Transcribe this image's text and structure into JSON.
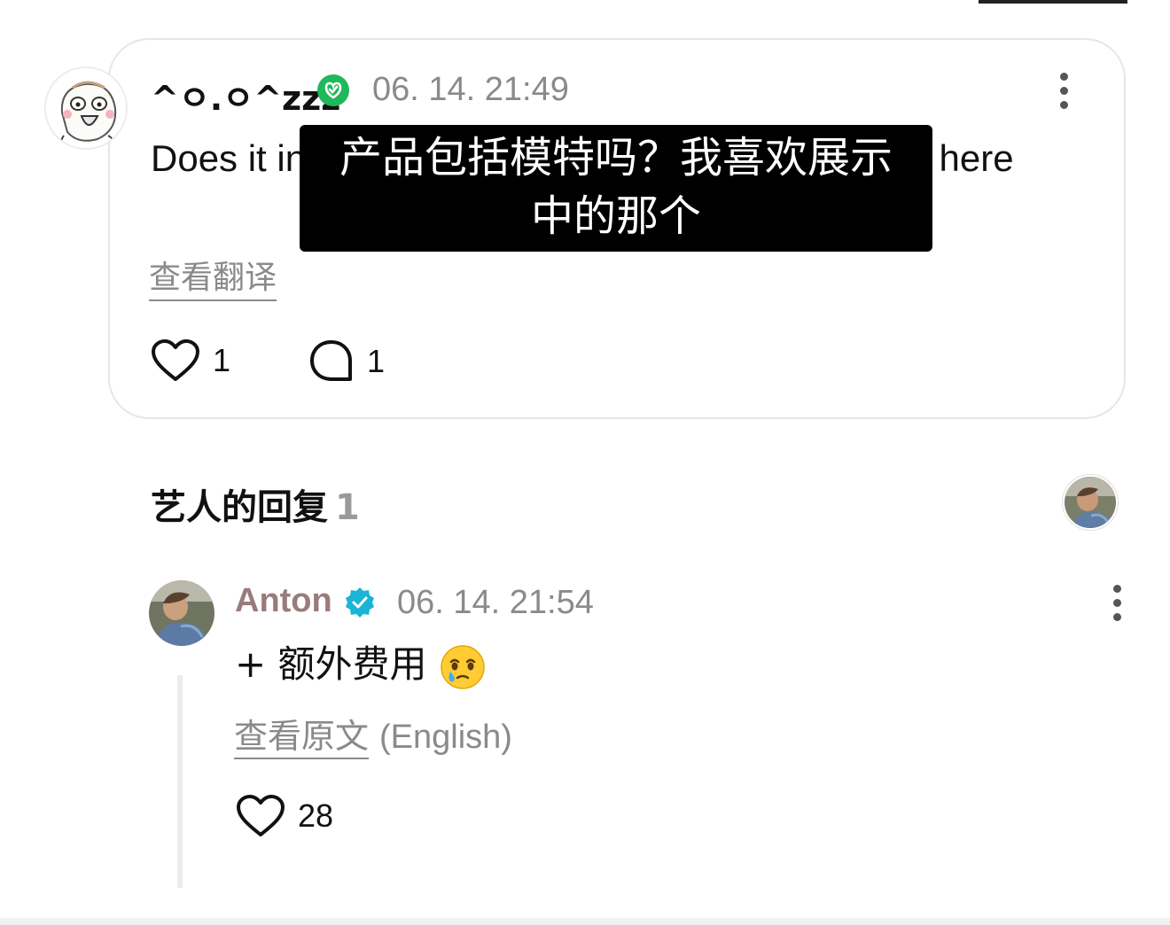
{
  "comment": {
    "username": "^ㅇ.ㅇ^zzz",
    "timestamp": "06. 14. 21:49",
    "text": "Does it include the model? I like the one shown here",
    "translate_label": "查看翻译",
    "likes": "1",
    "replies": "1",
    "verified_color": "#1fb85a",
    "icons": [
      "avatar-icon",
      "verified-badge-icon",
      "more-vertical-icon",
      "heart-icon",
      "comment-bubble-icon"
    ]
  },
  "overlay": {
    "line1": "产品包括模特吗？我喜欢展示",
    "line2": "中的那个"
  },
  "artist_section": {
    "title": "艺人的回复",
    "count": "1"
  },
  "reply": {
    "name": "Anton",
    "timestamp": "06. 14. 21:54",
    "text": "+ 额外费用",
    "emoji": "face-holding-back-tears",
    "original_label": "查看原文",
    "original_lang": "(English)",
    "likes": "28",
    "verified_color": "#1ab4d6",
    "name_color": "#9a7b7b"
  }
}
